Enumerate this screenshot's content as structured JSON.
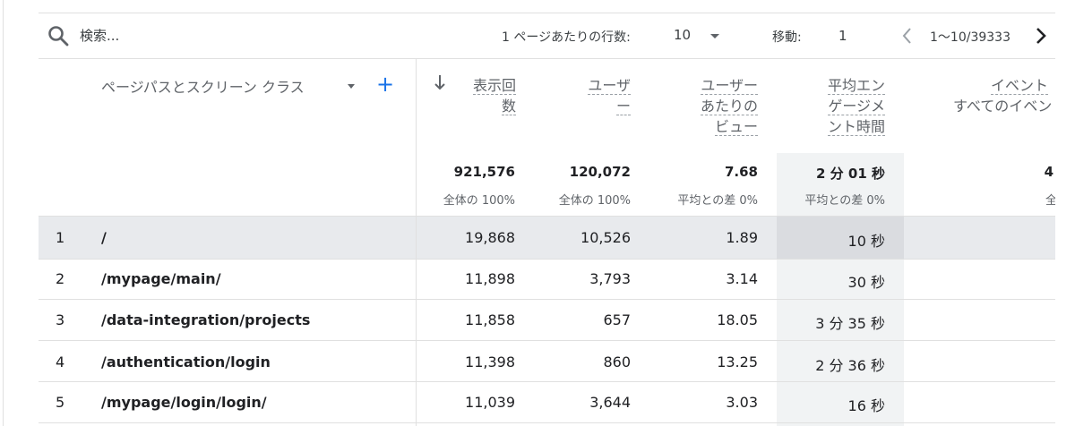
{
  "toolbar": {
    "search_placeholder": "検索...",
    "rows_per_page_label": "1 ページあたりの行数:",
    "rows_per_page_value": "10",
    "goto_label": "移動:",
    "goto_value": "1",
    "range_text": "1〜10/39333"
  },
  "table": {
    "dimension_header": "ページパスとスクリーン クラス",
    "add_dimension": "+",
    "metric_headers": [
      {
        "lines": [
          "表示回",
          "数"
        ],
        "sorted": true
      },
      {
        "lines": [
          "ユーザ",
          "ー"
        ]
      },
      {
        "lines": [
          "ユーザー",
          "あたりの",
          "ビュー"
        ]
      },
      {
        "lines": [
          "平均エン",
          "ゲージメ",
          "ント時間"
        ]
      },
      {
        "lines": [
          "イベント",
          "すべてのイベン"
        ]
      }
    ],
    "totals": [
      {
        "value": "921,576",
        "sub": "全体の 100%"
      },
      {
        "value": "120,072",
        "sub": "全体の 100%"
      },
      {
        "value": "7.68",
        "sub": "平均との差 0%"
      },
      {
        "value": "2 分 01 秒",
        "sub": "平均との差 0%"
      },
      {
        "value": "4",
        "sub": "全"
      }
    ],
    "rows": [
      {
        "index": "1",
        "path": "/",
        "views": "19,868",
        "users": "10,526",
        "per_user": "1.89",
        "engagement": "10 秒"
      },
      {
        "index": "2",
        "path": "/mypage/main/",
        "views": "11,898",
        "users": "3,793",
        "per_user": "3.14",
        "engagement": "30 秒"
      },
      {
        "index": "3",
        "path": "/data-integration/projects",
        "views": "11,858",
        "users": "657",
        "per_user": "18.05",
        "engagement": "3 分 35 秒"
      },
      {
        "index": "4",
        "path": "/authentication/login",
        "views": "11,398",
        "users": "860",
        "per_user": "13.25",
        "engagement": "2 分 36 秒"
      },
      {
        "index": "5",
        "path": "/mypage/login/login/",
        "views": "11,039",
        "users": "3,644",
        "per_user": "3.03",
        "engagement": "16 秒"
      }
    ]
  },
  "colors": {
    "accent": "#1a73e8",
    "selected_row": "#e8eaed",
    "highlight_column": "#f1f3f4"
  }
}
